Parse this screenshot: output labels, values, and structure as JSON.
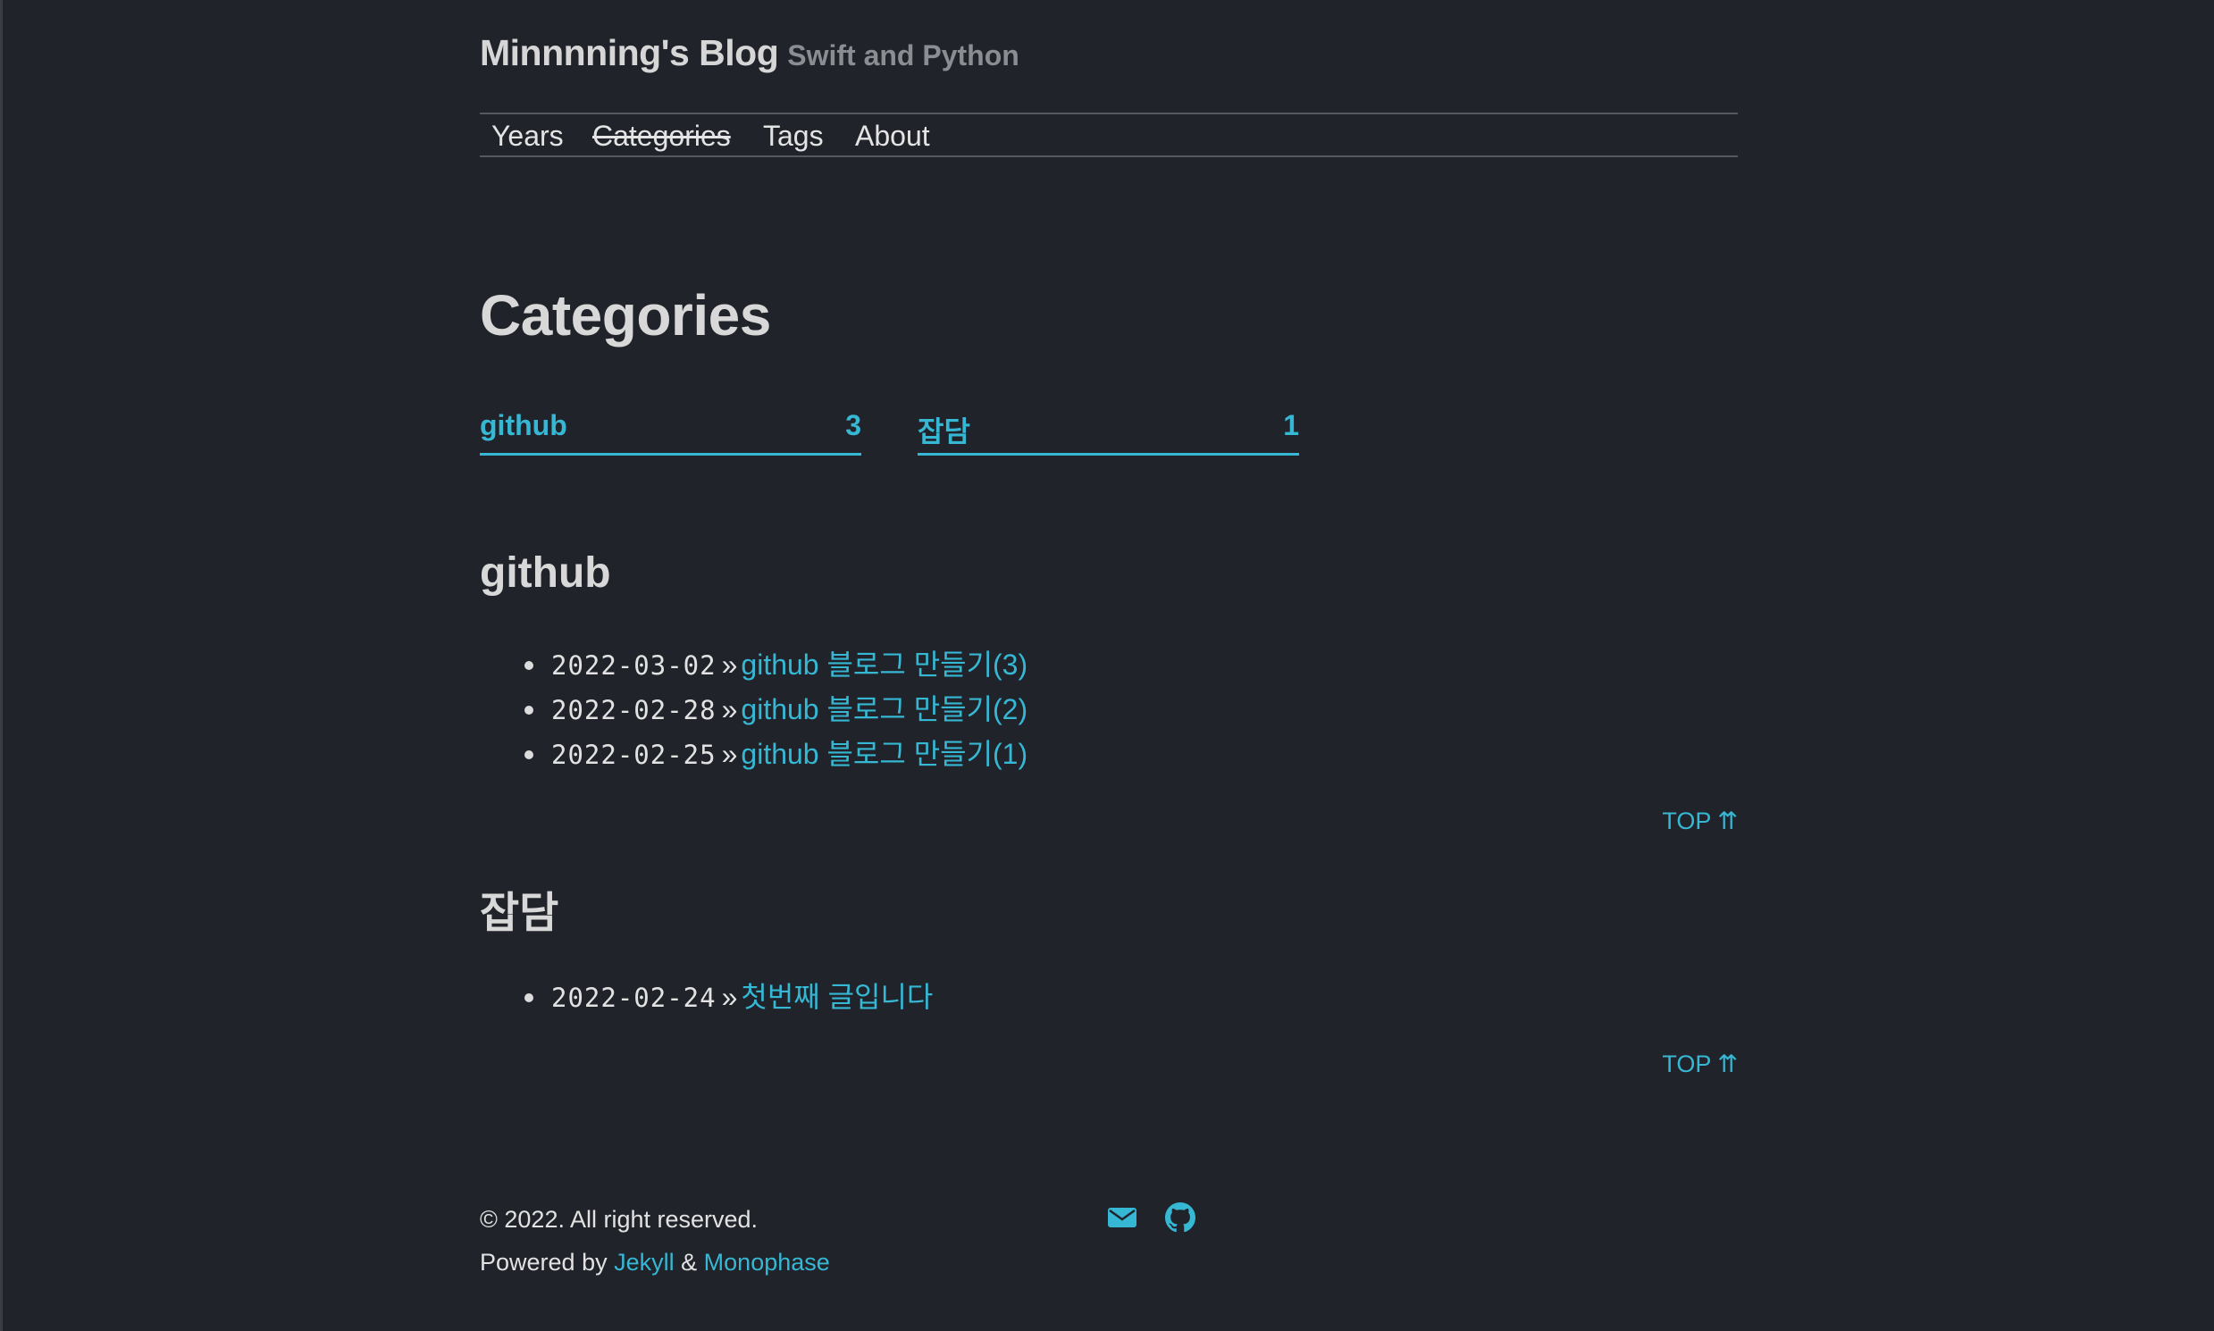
{
  "header": {
    "title": "Minnnning's Blog",
    "subtitle": "Swift and Python"
  },
  "nav": {
    "items": [
      {
        "label": "Years"
      },
      {
        "label": "Categories",
        "current": true
      },
      {
        "label": "Tags"
      },
      {
        "label": "About"
      }
    ]
  },
  "page": {
    "title": "Categories"
  },
  "categories_summary": [
    {
      "name": "github",
      "count": "3"
    },
    {
      "name": "잡담",
      "count": "1"
    }
  ],
  "sections": [
    {
      "title": "github",
      "posts": [
        {
          "date": "2022-03-02",
          "sep": "»",
          "title": "github 블로그 만들기(3)"
        },
        {
          "date": "2022-02-28",
          "sep": "»",
          "title": "github 블로그 만들기(2)"
        },
        {
          "date": "2022-02-25",
          "sep": "»",
          "title": "github 블로그 만들기(1)"
        }
      ],
      "top_label": "TOP ⇈"
    },
    {
      "title": "잡담",
      "posts": [
        {
          "date": "2022-02-24",
          "sep": "»",
          "title": "첫번째 글입니다"
        }
      ],
      "top_label": "TOP ⇈"
    }
  ],
  "footer": {
    "copyright": "© 2022. All right reserved.",
    "powered_prefix": "Powered by",
    "jekyll": "Jekyll",
    "amp": "&",
    "monophase": "Monophase",
    "icons": [
      "mail-icon",
      "github-icon"
    ]
  },
  "colors": {
    "background": "#202329",
    "accent": "#36b7d4",
    "text": "#dcdcdc",
    "muted": "#8a8d92"
  }
}
